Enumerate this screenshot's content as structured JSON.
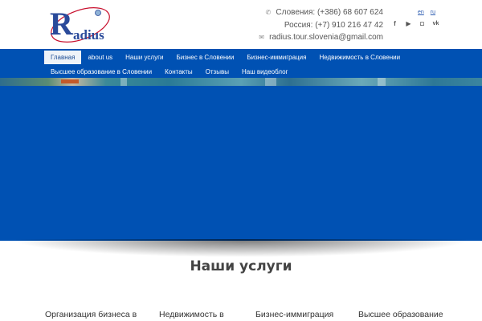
{
  "header": {
    "logo_text": "adius",
    "logo_initial": "R",
    "phone_slovenia": "Словения: (+386) 68 607 624",
    "phone_russia": "Россия: (+7) 910 216 47 42",
    "email": "radius.tour.slovenia@gmail.com",
    "languages": [
      "en",
      "ru"
    ],
    "socials": [
      "facebook-icon",
      "youtube-icon",
      "instagram-icon",
      "vk-icon"
    ]
  },
  "nav": {
    "row1": [
      "Главная",
      "about us",
      "Наши услуги",
      "Бизнес в Словении",
      "Бизнес-иммиграция",
      "Недвижимость в Словении"
    ],
    "row2": [
      "Высшее образование в Словении",
      "Контакты",
      "Отзывы",
      "Наш видеоблог"
    ]
  },
  "colors": {
    "brand_blue": "#0051b3",
    "logo_blue": "#2a4a9a",
    "logo_red": "#c8102e"
  },
  "services": {
    "title": "Наши услуги",
    "items": [
      "Организация бизнеса в",
      "Недвижимость в",
      "Бизнес-иммиграция",
      "Высшее образование"
    ]
  }
}
